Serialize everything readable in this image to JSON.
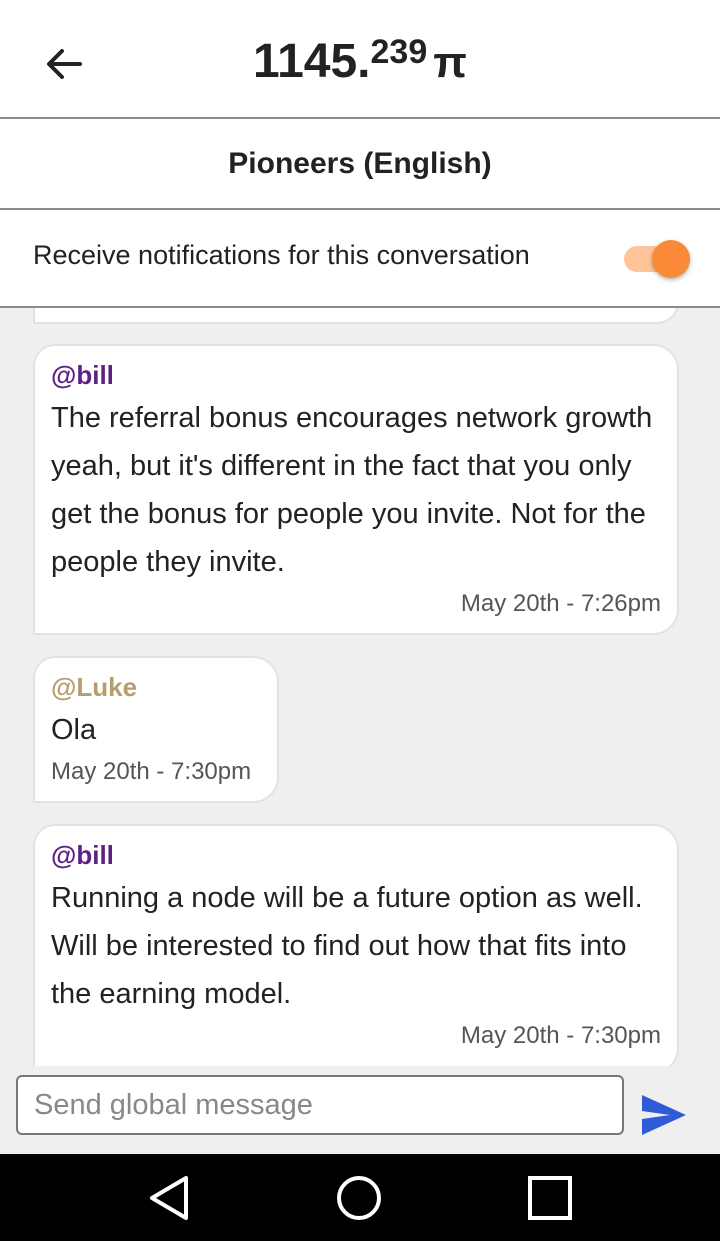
{
  "header": {
    "balance_whole": "1145.",
    "balance_fraction": "239",
    "currency_symbol": "π"
  },
  "conversation": {
    "title": "Pioneers (English)"
  },
  "notifications": {
    "label": "Receive notifications for this conversation",
    "enabled": true
  },
  "messages": [
    {
      "author": "@bill",
      "text": "The referral bonus encourages network growth yeah, but it's different in the fact that you only get the bonus for people you invite. Not for the people they invite.",
      "time": "May 20th - 7:26pm"
    },
    {
      "author": "@Luke",
      "text": "Ola",
      "time": "May 20th - 7:30pm"
    },
    {
      "author": "@bill",
      "text": "Running a node will be a future option as well. Will be interested to find out how that fits into the earning model.",
      "time": "May 20th - 7:30pm"
    }
  ],
  "composer": {
    "placeholder": "Send global message",
    "value": ""
  },
  "colors": {
    "bill_author": "#5b2283",
    "luke_author": "#b89e6c",
    "toggle_on": "#fb8a38",
    "send_icon": "#2f5bd8"
  },
  "icons": {
    "back": "arrow-left-icon",
    "send": "send-icon",
    "nav_back": "triangle-back-icon",
    "nav_home": "circle-home-icon",
    "nav_recents": "square-recents-icon"
  }
}
